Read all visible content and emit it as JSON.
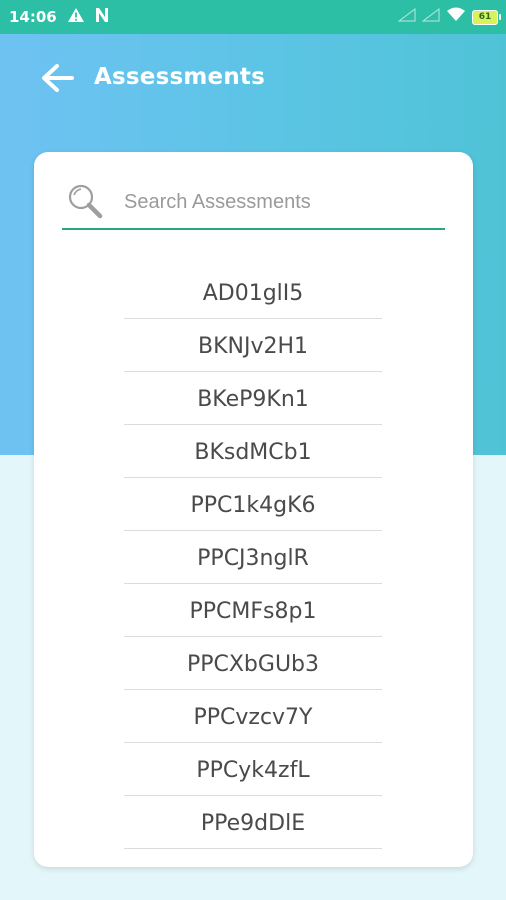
{
  "status_bar": {
    "time": "14:06",
    "battery": "61",
    "icons": [
      "warning-icon",
      "n-icon",
      "signal-icon",
      "signal-icon",
      "wifi-icon",
      "battery-icon"
    ]
  },
  "header": {
    "title": "Assessments"
  },
  "search": {
    "placeholder": "Search Assessments",
    "value": ""
  },
  "colors": {
    "status_bar": "#2dbfa6",
    "header_gradient_start": "#6ec2f2",
    "header_gradient_end": "#4fc3d6",
    "accent_underline": "#27a882",
    "page_bg": "#e3f6fa"
  },
  "assessments": [
    "AD01glI5",
    "BKNJv2H1",
    "BKeP9Kn1",
    "BKsdMCb1",
    "PPC1k4gK6",
    "PPCJ3nglR",
    "PPCMFs8p1",
    "PPCXbGUb3",
    "PPCvzcv7Y",
    "PPCyk4zfL",
    "PPe9dDlE"
  ]
}
